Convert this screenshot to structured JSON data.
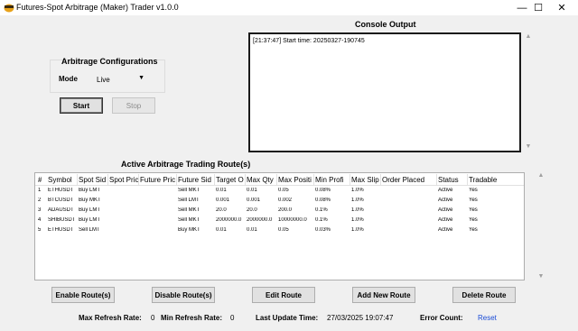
{
  "window": {
    "title": "Futures-Spot Arbitrage (Maker) Trader v1.0.0",
    "minimize": "—",
    "maximize": "☐",
    "close": "✕"
  },
  "config": {
    "title": "Arbitrage Configurations",
    "mode_label": "Mode",
    "mode_value": "Live",
    "start_label": "Start",
    "stop_label": "Stop"
  },
  "console": {
    "title": "Console Output",
    "lines": [
      "[21:37:47] Start time: 20250327-190745"
    ]
  },
  "routes": {
    "title": "Active Arbitrage Trading Route(s)",
    "columns": [
      "#",
      "Symbol",
      "Spot Sid",
      "Spot Pric",
      "Future Pric",
      "Future Sid",
      "Target O",
      "Max Qty",
      "Max Positi",
      "Min Profi",
      "Max Slip",
      "Order Placed",
      "Status",
      "Tradable"
    ],
    "rows": [
      [
        "1",
        "ETHUSDT",
        "Buy LMT",
        "",
        "",
        "Sell MKT",
        "0.01",
        "0.01",
        "0.05",
        "0.08%",
        "1.0%",
        "",
        "Active",
        "Yes"
      ],
      [
        "2",
        "BTCUSDT",
        "Buy MKT",
        "",
        "",
        "Sell LMT",
        "0.001",
        "0.001",
        "0.002",
        "0.08%",
        "1.0%",
        "",
        "Active",
        "Yes"
      ],
      [
        "3",
        "ADAUSDT",
        "Buy LMT",
        "",
        "",
        "Sell MKT",
        "20.0",
        "20.0",
        "200.0",
        "0.1%",
        "1.0%",
        "",
        "Active",
        "Yes"
      ],
      [
        "4",
        "SHIBUSDT",
        "Buy LMT",
        "",
        "",
        "Sell MKT",
        "2000000.0",
        "2000000.0",
        "10000000.0",
        "0.1%",
        "1.0%",
        "",
        "Active",
        "Yes"
      ],
      [
        "5",
        "ETHUSDT",
        "Sell LMT",
        "",
        "",
        "Buy MKT",
        "0.01",
        "0.01",
        "0.05",
        "0.03%",
        "1.0%",
        "",
        "Active",
        "Yes"
      ]
    ]
  },
  "actions": {
    "enable": "Enable Route(s)",
    "disable": "Disable Route(s)",
    "edit": "Edit Route",
    "add": "Add New Route",
    "delete": "Delete Route"
  },
  "footer": {
    "max_refresh_label": "Max Refresh Rate:",
    "max_refresh_value": "0",
    "min_refresh_label": "Min Refresh Rate:",
    "min_refresh_value": "0",
    "last_update_label": "Last Update Time:",
    "last_update_value": "27/03/2025 19:07:47",
    "error_label": "Error Count:",
    "reset_label": "Reset"
  }
}
